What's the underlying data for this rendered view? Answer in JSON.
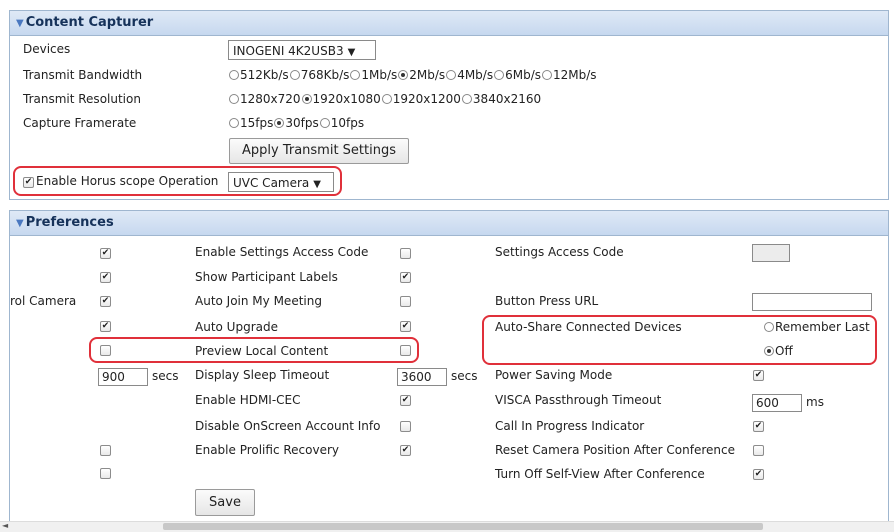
{
  "content_capturer": {
    "title": "Content Capturer",
    "devices_label": "Devices",
    "devices_value": "INOGENI 4K2USB3",
    "bandwidth_label": "Transmit Bandwidth",
    "bandwidth_options": [
      "512Kb/s",
      "768Kb/s",
      "1Mb/s",
      "2Mb/s",
      "4Mb/s",
      "6Mb/s",
      "12Mb/s"
    ],
    "bandwidth_selected": "2Mb/s",
    "resolution_label": "Transmit Resolution",
    "resolution_options": [
      "1280x720",
      "1920x1080",
      "1920x1200",
      "3840x2160"
    ],
    "resolution_selected": "1920x1080",
    "framerate_label": "Capture Framerate",
    "framerate_options": [
      "15fps",
      "30fps",
      "10fps"
    ],
    "framerate_selected": "30fps",
    "apply_button": "Apply Transmit Settings",
    "horus_label": "Enable Horus scope Operation",
    "horus_checked": true,
    "camera_value": "UVC Camera"
  },
  "preferences": {
    "title": "Preferences",
    "control_camera_label": "rol Camera",
    "left_checks": [
      true,
      true,
      true,
      true,
      false,
      null,
      null,
      null,
      false,
      false
    ],
    "left_seconds_value": "900",
    "secs_unit": "secs",
    "middle_rows": [
      {
        "label": "Enable Settings Access Code",
        "checked": false
      },
      {
        "label": "Show Participant Labels",
        "checked": true
      },
      {
        "label": "Auto Join My Meeting",
        "checked": false
      },
      {
        "label": "Auto Upgrade",
        "checked": true
      },
      {
        "label": "Preview Local Content",
        "checked": false
      },
      {
        "label": "Display Sleep Timeout",
        "value": "3600",
        "unit": "secs"
      },
      {
        "label": "Enable HDMI-CEC",
        "checked": true
      },
      {
        "label": "Disable OnScreen Account Info",
        "checked": false
      },
      {
        "label": "Enable Prolific Recovery",
        "checked": true
      }
    ],
    "right_rows": [
      {
        "label": "Settings Access Code"
      },
      {
        "label": "Button Press URL"
      },
      {
        "label": "Auto-Share Connected Devices",
        "options": [
          "Remember Last",
          "Off"
        ],
        "selected": "Off"
      },
      {
        "label": "Power Saving Mode",
        "checked": true
      },
      {
        "label": "VISCA Passthrough Timeout",
        "value": "600",
        "unit": "ms"
      },
      {
        "label": "Call In Progress Indicator",
        "checked": true
      },
      {
        "label": "Reset Camera Position After Conference",
        "checked": false
      },
      {
        "label": "Turn Off Self-View After Conference",
        "checked": true
      }
    ],
    "save_button": "Save"
  },
  "scrollbar": {
    "left_arrow": "◄"
  }
}
